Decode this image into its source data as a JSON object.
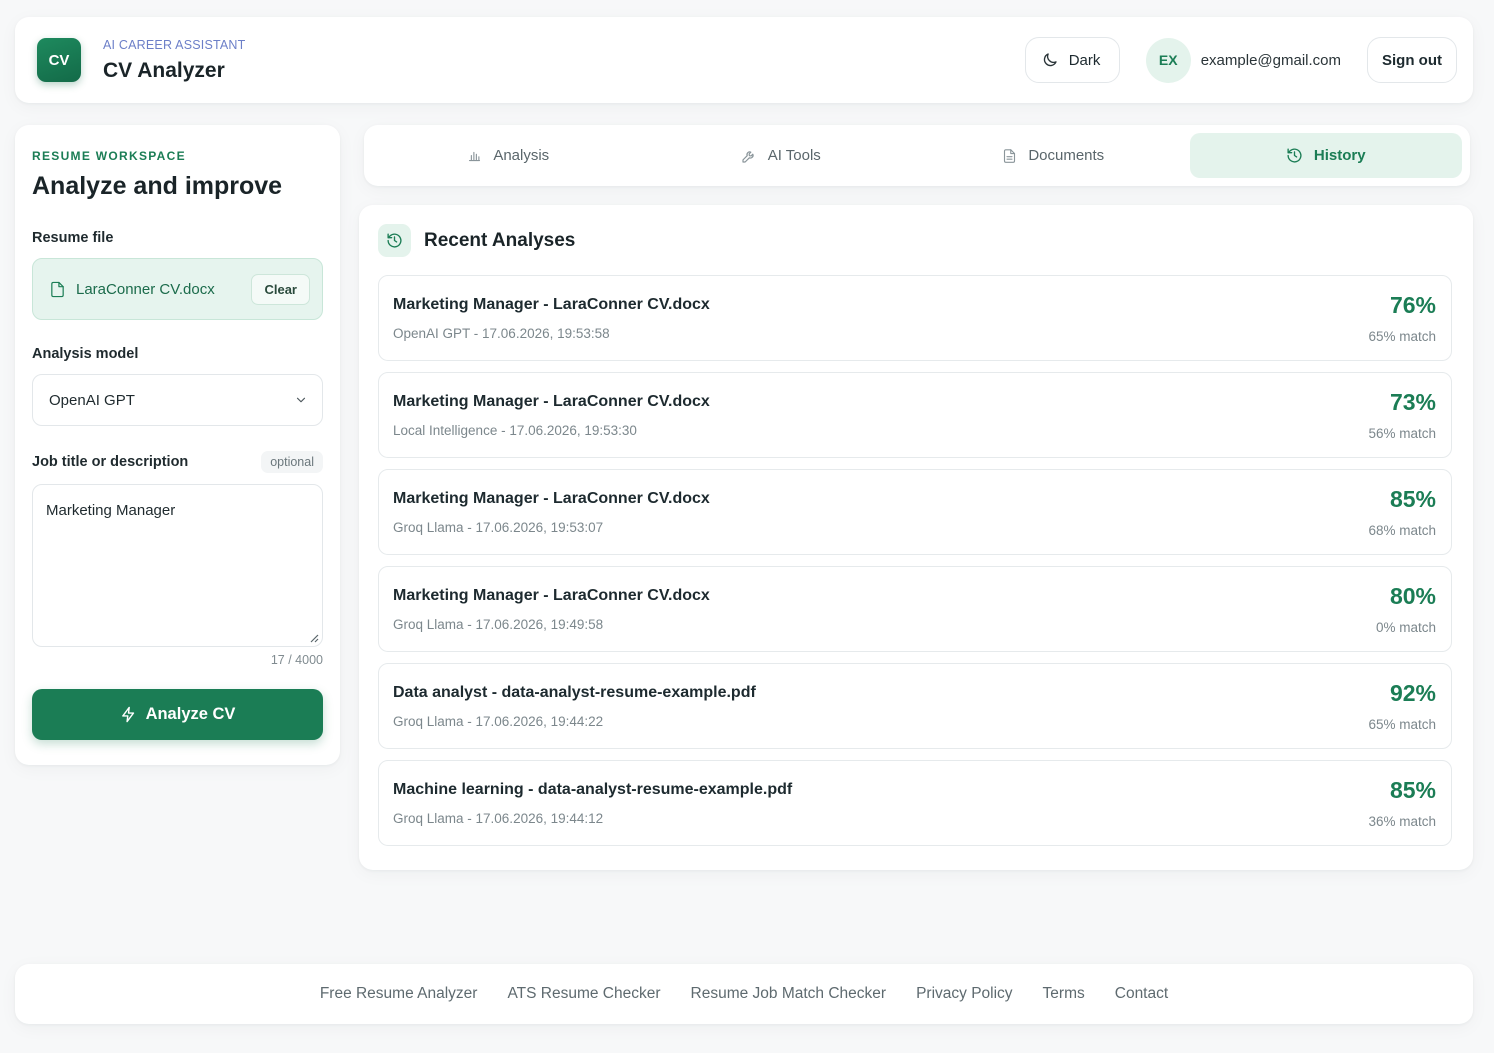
{
  "header": {
    "logo_text": "CV",
    "brand_subtitle": "AI CAREER ASSISTANT",
    "brand_title": "CV Analyzer",
    "theme_label": "Dark",
    "avatar_initials": "EX",
    "user_email": "example@gmail.com",
    "signout_label": "Sign out"
  },
  "sidebar": {
    "eyebrow": "RESUME WORKSPACE",
    "title": "Analyze and improve",
    "resume_label": "Resume file",
    "file_name": "LaraConner CV.docx",
    "clear_label": "Clear",
    "model_label": "Analysis model",
    "model_value": "OpenAI GPT",
    "job_label": "Job title or description",
    "optional_label": "optional",
    "job_value": "Marketing Manager",
    "char_count": "17 / 4000",
    "analyze_label": "Analyze CV"
  },
  "tabs": [
    {
      "label": "Analysis",
      "icon": "bar-chart-icon",
      "active": false
    },
    {
      "label": "AI Tools",
      "icon": "wrench-icon",
      "active": false
    },
    {
      "label": "Documents",
      "icon": "document-icon",
      "active": false
    },
    {
      "label": "History",
      "icon": "history-icon",
      "active": true
    }
  ],
  "main": {
    "title": "Recent Analyses",
    "analyses": [
      {
        "title": "Marketing Manager - LaraConner CV.docx",
        "meta": "OpenAI GPT - 17.06.2026, 19:53:58",
        "score": "76%",
        "match": "65% match"
      },
      {
        "title": "Marketing Manager - LaraConner CV.docx",
        "meta": "Local Intelligence - 17.06.2026, 19:53:30",
        "score": "73%",
        "match": "56% match"
      },
      {
        "title": "Marketing Manager - LaraConner CV.docx",
        "meta": "Groq Llama - 17.06.2026, 19:53:07",
        "score": "85%",
        "match": "68% match"
      },
      {
        "title": "Marketing Manager - LaraConner CV.docx",
        "meta": "Groq Llama - 17.06.2026, 19:49:58",
        "score": "80%",
        "match": "0% match"
      },
      {
        "title": "Data analyst - data-analyst-resume-example.pdf",
        "meta": "Groq Llama - 17.06.2026, 19:44:22",
        "score": "92%",
        "match": "65% match"
      },
      {
        "title": "Machine learning - data-analyst-resume-example.pdf",
        "meta": "Groq Llama - 17.06.2026, 19:44:12",
        "score": "85%",
        "match": "36% match"
      }
    ]
  },
  "footer": {
    "links": [
      "Free Resume Analyzer",
      "ATS Resume Checker",
      "Resume Job Match Checker",
      "Privacy Policy",
      "Terms",
      "Contact"
    ]
  },
  "colors": {
    "accent": "#1b7d55",
    "accent_light": "#e4f3ec",
    "brand_subtitle": "#6c7fc8",
    "background": "#f7f8f9"
  }
}
